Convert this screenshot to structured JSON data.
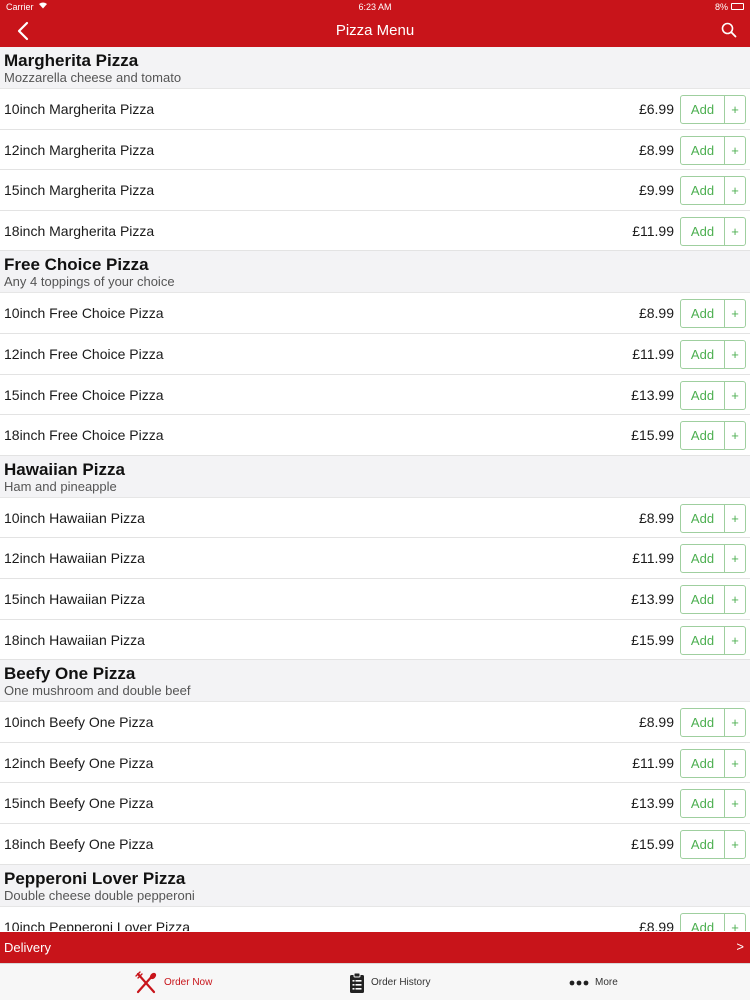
{
  "status_bar": {
    "carrier": "Carrier",
    "time": "6:23 AM",
    "battery": "8%"
  },
  "nav": {
    "title": "Pizza Menu"
  },
  "sections": [
    {
      "title": "Margherita Pizza",
      "subtitle": "Mozzarella cheese and tomato",
      "items": [
        {
          "name": "10inch Margherita Pizza",
          "price": "£6.99"
        },
        {
          "name": "12inch Margherita Pizza",
          "price": "£8.99"
        },
        {
          "name": "15inch Margherita Pizza",
          "price": "£9.99"
        },
        {
          "name": "18inch Margherita Pizza",
          "price": "£11.99"
        }
      ]
    },
    {
      "title": "Free Choice Pizza",
      "subtitle": "Any 4 toppings of your choice",
      "items": [
        {
          "name": "10inch Free Choice Pizza",
          "price": "£8.99"
        },
        {
          "name": "12inch Free Choice Pizza",
          "price": "£11.99"
        },
        {
          "name": "15inch Free Choice Pizza",
          "price": "£13.99"
        },
        {
          "name": "18inch Free Choice Pizza",
          "price": "£15.99"
        }
      ]
    },
    {
      "title": "Hawaiian Pizza",
      "subtitle": "Ham and pineapple",
      "items": [
        {
          "name": "10inch Hawaiian Pizza",
          "price": "£8.99"
        },
        {
          "name": "12inch Hawaiian Pizza",
          "price": "£11.99"
        },
        {
          "name": "15inch Hawaiian Pizza",
          "price": "£13.99"
        },
        {
          "name": "18inch Hawaiian Pizza",
          "price": "£15.99"
        }
      ]
    },
    {
      "title": "Beefy One Pizza",
      "subtitle": "One mushroom and double beef",
      "items": [
        {
          "name": "10inch Beefy One Pizza",
          "price": "£8.99"
        },
        {
          "name": "12inch Beefy One Pizza",
          "price": "£11.99"
        },
        {
          "name": "15inch Beefy One Pizza",
          "price": "£13.99"
        },
        {
          "name": "18inch Beefy One Pizza",
          "price": "£15.99"
        }
      ]
    },
    {
      "title": "Pepperoni Lover Pizza",
      "subtitle": "Double cheese double pepperoni",
      "items": [
        {
          "name": "10inch Pepperoni Lover Pizza",
          "price": "£8.99"
        }
      ]
    }
  ],
  "add_button": {
    "label": "Add",
    "plus": "+"
  },
  "delivery_bar": {
    "label": "Delivery",
    "chevron": ">"
  },
  "tabs": [
    {
      "label": "Order Now",
      "icon": "fork-knife-icon"
    },
    {
      "label": "Order History",
      "icon": "clipboard-icon"
    },
    {
      "label": "More",
      "icon": "more-dots-icon"
    }
  ],
  "colors": {
    "primary": "#c8141a",
    "add_green": "#4caf50",
    "section_bg": "#f3f3f5"
  }
}
